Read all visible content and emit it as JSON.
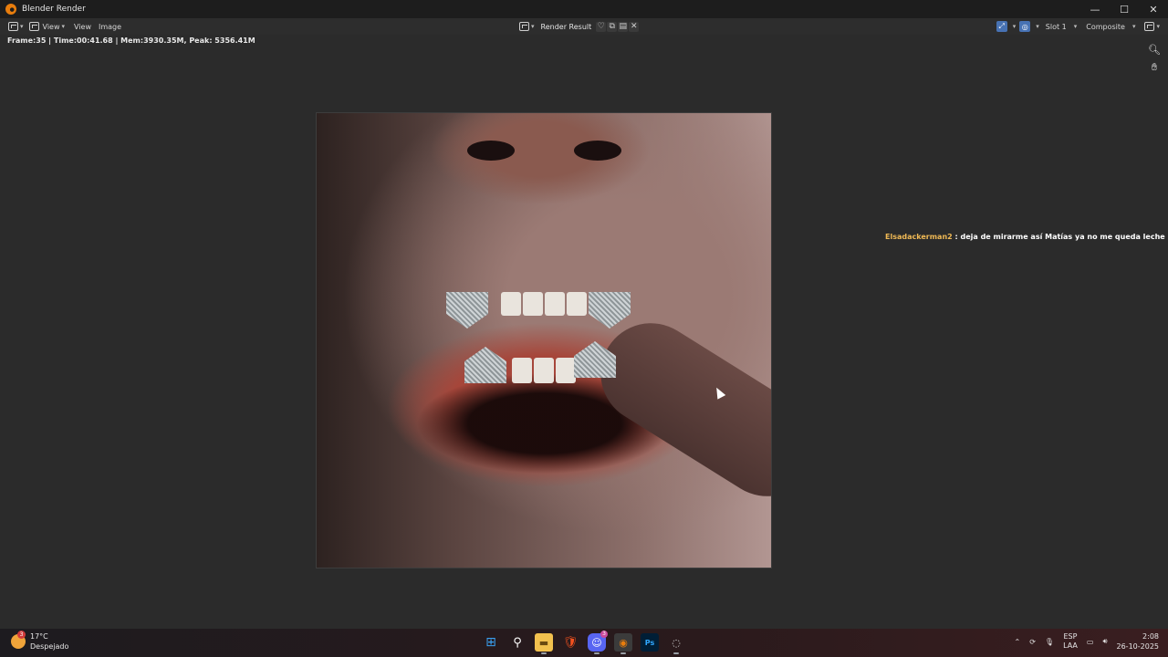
{
  "window": {
    "title": "Blender Render",
    "controls": {
      "minimize": "—",
      "maximize": "☐",
      "close": "✕"
    }
  },
  "header": {
    "view_menu_1": "View",
    "view_menu_2": "View",
    "image_menu": "Image",
    "render_result": "Render Result",
    "slot": "Slot 1",
    "pass": "Composite"
  },
  "stats": "Frame:35 | Time:00:41.68 | Mem:3930.35M, Peak: 5356.41M",
  "chat": {
    "user": "Elsadackerman2",
    "message": " : deja de mirarme así Matías ya no me queda leche pa darte"
  },
  "taskbar": {
    "weather_badge": "3",
    "temperature": "17°C",
    "condition": "Despejado",
    "discord_badge": "3",
    "lang_top": "ESP",
    "lang_bottom": "LAA",
    "time": "2:08",
    "date": "26-10-2025"
  },
  "icons": [
    "blender-logo-icon",
    "editor-type-icon",
    "image-icon",
    "zoom-icon",
    "hand-icon",
    "windows-start-icon",
    "search-icon",
    "file-explorer-icon",
    "brave-icon",
    "discord-icon",
    "blender-icon",
    "photoshop-icon",
    "obs-icon"
  ]
}
